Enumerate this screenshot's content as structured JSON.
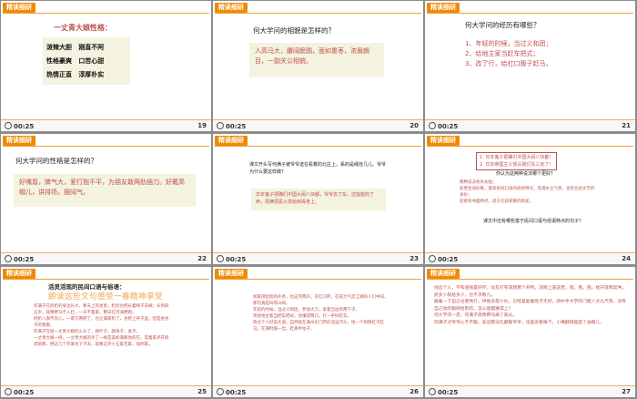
{
  "header_tag": "精读细研",
  "time": "00:25",
  "slides": {
    "s19": {
      "num": "19",
      "title": "一丈青大娘性格：",
      "traits": [
        [
          "泼辣大胆",
          "刚直不阿"
        ],
        [
          "性格豪爽",
          "口苦心甜"
        ],
        [
          "热情正直",
          "淳厚朴实"
        ]
      ]
    },
    "s20": {
      "num": "20",
      "question": "何大学问的相貌是怎样的？",
      "answer": "人高马大，腰阔膀圆，面如重枣，浓眉朗目，一副关公相貌。"
    },
    "s21": {
      "num": "21",
      "question": "何大学问的经历有哪些？",
      "items": [
        "1、年轻的时候，当过义和团；",
        "2、给地主家当赶车把式；",
        "3、改了行，给杠口贩子赶马。"
      ]
    },
    "s22": {
      "num": "22",
      "question": "何大学问的性格是怎样的？",
      "answer": "好嘴唇，脾气大，爱打抱不平，为朋友敢两肋插刀。好戴高帽儿，讲排场，摆阔气。"
    },
    "s23": {
      "num": "23",
      "question": "课文开头写何满子被爷爷送在看着的北庄上，系的是绳拴几儿。爷爷为什么要这样做？",
      "answer": "日本鬼子把确们中国大闹八块都，爷爷去了东，还指望的了命，把满把恶火发给到得身上。"
    },
    "s24": {
      "num": "24",
      "items": [
        "1. 日本鬼子把确们中国大闹八块都！",
        "2. 日本帝国主义侵占我们东三省了！"
      ],
      "question": "你认为这两种说法哪个更好？",
      "points": [
        "两种说法各有长短；",
        "前者生动形象，富有民间口语的俗语特点，充满乡土气息，也符合此文学的身份；",
        "后者有书面特点，适于比较郑重的叙述。"
      ],
      "question2": "课文中还有哪些富于民间口语与俗语特点的句子？"
    },
    "s25": {
      "num": "25",
      "title": "活灵活现的民间口语与俗语：",
      "banner": "朗读这些文句感受一番精神享受",
      "lines": [
        "何满子在奶奶的身边长大，要天上的星星，奶奶也把长着梯子去摘；长到四五岁，就像野马不入栏，一天不着家，整日在河滩野跑。",
        "奶奶八旗不饮心，一家只两把了，也让满家奶了，也把上井子里，但是他也子的我看。",
        "何满子在屋一丈青大娘的火头了，顾叶子，颜珠子，会子。",
        "一丈青大娘一捋，一丈青大娘的手了一样是美如满那你的在，常着家评开跨黑暗那，把这几个开来也下子去，就像这开十五家无家，加你家。"
      ]
    },
    "s26": {
      "num": "26",
      "lines": [
        "如家捞起他的外务，也这完两声，在红口所，在前力气走江湖的人们中间，那可真是叫得山响。",
        "年轻的时候，当过义和团，参加大刀，拿着当边有两下子。",
        "现他地主家当把车把式，会懂得两口，打一手好赶车。",
        "改过个人好说大道，自然就在满州东门所的北运河头，给一个财政杠子赶马。在满时拨一出，赶真半拉子。"
      ]
    },
    "s27": {
      "num": "27",
      "lines": [
        "他这个人，不和道钱是好坏，伙友打有滚我那个开所，没跑上道说老，就，抱，抱，给开就两常凭，抓多少就给多少，也不求数儿。",
        "跟着一下自己也使凭打，供他去帮小伙，已经是能着性子无好，四中手大学的门框八丈九尺高，没有自己动的银牌给别的，怎么能都难得上？",
        "何大学问一走，何满子就像野马摘了笼头。",
        "何满子对爷爷心不不服，拿出那法孔翻股爷爷，也是会看根下，小嘴翻得能挂个油瓶儿。"
      ]
    }
  }
}
